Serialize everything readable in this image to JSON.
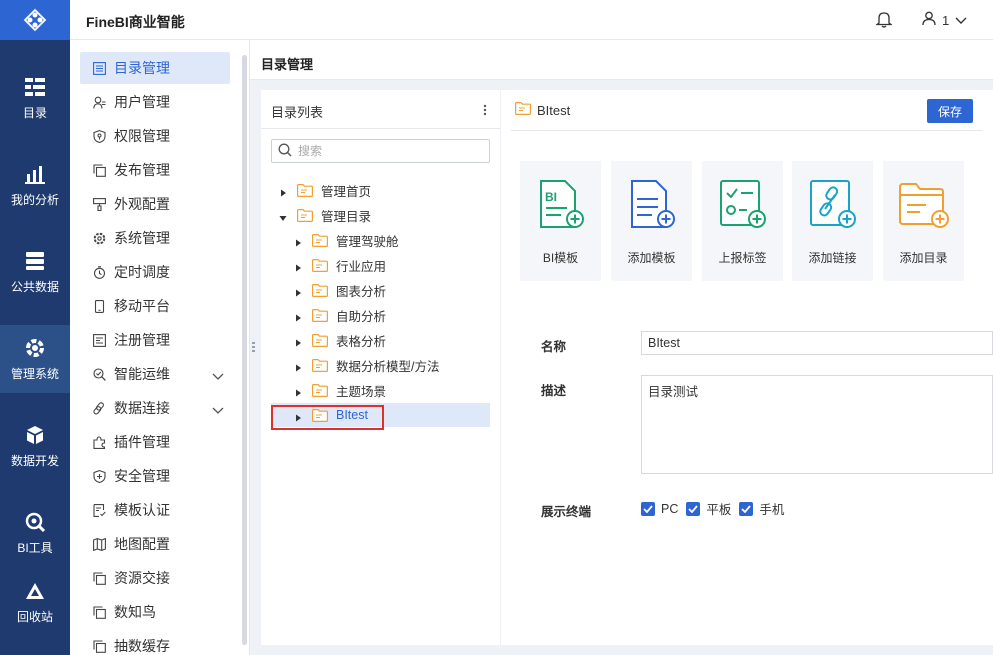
{
  "app": {
    "brand": "FineBI商业智能",
    "user_name": "1"
  },
  "colors": {
    "rail": "#1e3a6e",
    "logo_bg": "#2d66d3",
    "accent": "#2d66d3",
    "highlight": "#e0302c"
  },
  "rail": {
    "items": [
      {
        "label": "目录",
        "icon": "catalog-icon"
      },
      {
        "label": "我的分析",
        "icon": "analysis-icon"
      },
      {
        "label": "公共数据",
        "icon": "data-icon"
      },
      {
        "label": "管理系统",
        "icon": "gear-icon",
        "active": true
      },
      {
        "label": "数据开发",
        "icon": "cube-icon"
      },
      {
        "label": "BI工具",
        "icon": "tool-icon"
      },
      {
        "label": "回收站",
        "icon": "recycle-icon"
      }
    ]
  },
  "subnav": {
    "items": [
      {
        "label": "目录管理",
        "icon": "list-icon",
        "active": true
      },
      {
        "label": "用户管理",
        "icon": "user-icon"
      },
      {
        "label": "权限管理",
        "icon": "shield-icon"
      },
      {
        "label": "发布管理",
        "icon": "copy-icon"
      },
      {
        "label": "外观配置",
        "icon": "brush-icon"
      },
      {
        "label": "系统管理",
        "icon": "settings-icon"
      },
      {
        "label": "定时调度",
        "icon": "timer-icon"
      },
      {
        "label": "移动平台",
        "icon": "mobile-icon"
      },
      {
        "label": "注册管理",
        "icon": "register-icon"
      },
      {
        "label": "智能运维",
        "icon": "ops-icon",
        "expandable": true
      },
      {
        "label": "数据连接",
        "icon": "link-icon",
        "expandable": true
      },
      {
        "label": "插件管理",
        "icon": "puzzle-icon"
      },
      {
        "label": "安全管理",
        "icon": "security-icon"
      },
      {
        "label": "模板认证",
        "icon": "cert-icon"
      },
      {
        "label": "地图配置",
        "icon": "map-icon"
      },
      {
        "label": "资源交接",
        "icon": "copy-icon"
      },
      {
        "label": "数知鸟",
        "icon": "copy-icon"
      },
      {
        "label": "抽数缓存",
        "icon": "copy-icon"
      }
    ]
  },
  "main": {
    "title": "目录管理"
  },
  "tree": {
    "header": "目录列表",
    "search_placeholder": "搜索",
    "nodes": [
      {
        "label": "管理首页",
        "level": 0,
        "expanded": false
      },
      {
        "label": "管理目录",
        "level": 0,
        "expanded": true
      },
      {
        "label": "管理驾驶舱",
        "level": 1
      },
      {
        "label": "行业应用",
        "level": 1
      },
      {
        "label": "图表分析",
        "level": 1
      },
      {
        "label": "自助分析",
        "level": 1
      },
      {
        "label": "表格分析",
        "level": 1
      },
      {
        "label": "数据分析模型/方法",
        "level": 1
      },
      {
        "label": "主题场景",
        "level": 1
      },
      {
        "label": "BItest",
        "level": 1,
        "selected": true
      }
    ]
  },
  "detail": {
    "title": "BItest",
    "save_label": "保存",
    "cards": [
      {
        "label": "BI模板",
        "icon": "bi-template-icon",
        "color": "#1aa36f"
      },
      {
        "label": "添加模板",
        "icon": "add-template-icon",
        "color": "#2d66d3"
      },
      {
        "label": "上报标签",
        "icon": "report-tag-icon",
        "color": "#1aa36f"
      },
      {
        "label": "添加链接",
        "icon": "add-link-icon",
        "color": "#1aa3c9"
      },
      {
        "label": "添加目录",
        "icon": "add-folder-icon",
        "color": "#f0a030"
      }
    ],
    "form": {
      "name_label": "名称",
      "name_value": "BItest",
      "desc_label": "描述",
      "desc_value": "目录测试",
      "terminal_label": "展示终端",
      "terminals": [
        "PC",
        "平板",
        "手机"
      ]
    }
  }
}
